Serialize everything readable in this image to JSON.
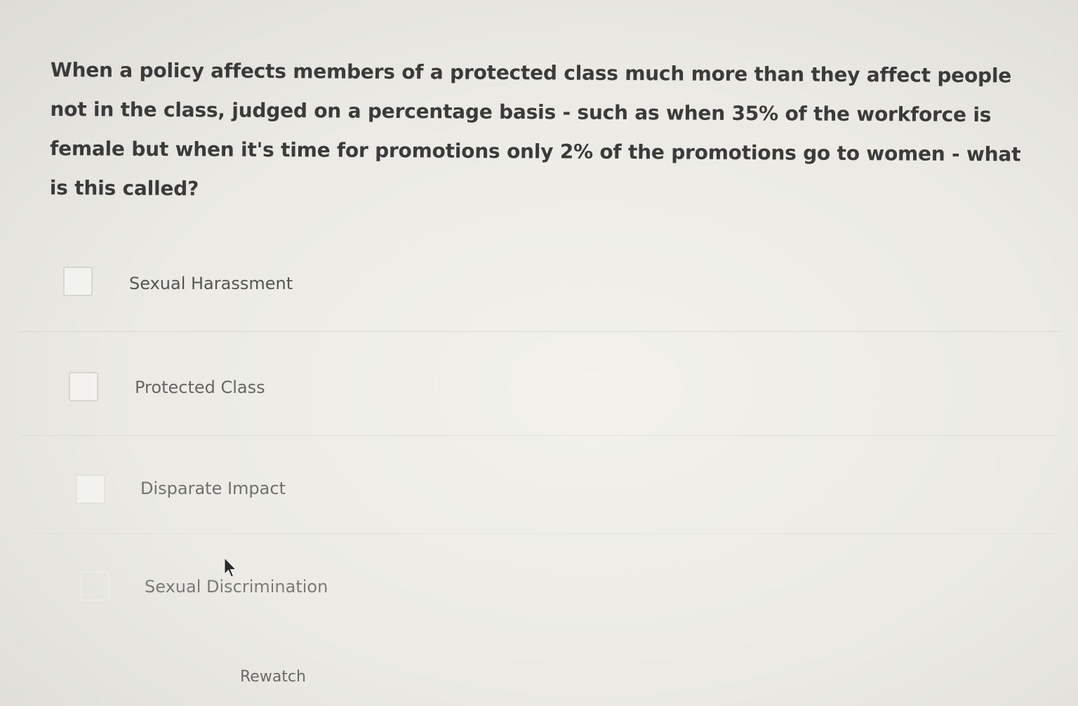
{
  "question": {
    "text": "When a policy affects members of a protected class much more than they affect people not in the class, judged on a percentage basis - such as when 35% of the workforce is female but when it's time for promotions only 2% of the promotions go to women - what is this called?"
  },
  "options": [
    {
      "label": "Sexual Harassment",
      "checked": false
    },
    {
      "label": "Protected Class",
      "checked": false
    },
    {
      "label": "Disparate Impact",
      "checked": false
    },
    {
      "label": "Sexual Discrimination",
      "checked": false
    }
  ],
  "actions": {
    "rewatch_label": "Rewatch"
  },
  "icons": {
    "pointer": "mouse-pointer-icon"
  },
  "colors": {
    "background": "#ebeae4",
    "text": "#3b3b3b",
    "checkbox_border": "#d6d6d1"
  }
}
